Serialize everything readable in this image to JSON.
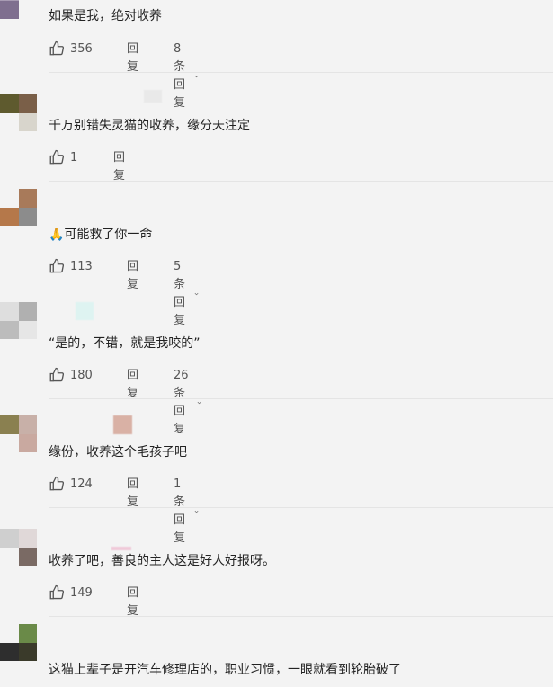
{
  "comments": [
    {
      "text": "如果是我，绝对收养",
      "likes": "356",
      "reply_label": "回复",
      "more_label": "8条回复"
    },
    {
      "text": "千万别错失灵猫的收养，缘分天注定",
      "likes": "1",
      "reply_label": "回复"
    },
    {
      "text": "🙏可能救了你一命",
      "likes": "113",
      "reply_label": "回复",
      "more_label": "5条回复"
    },
    {
      "text": "“是的，不错，就是我咬的”",
      "likes": "180",
      "reply_label": "回复",
      "more_label": "26条回复"
    },
    {
      "text": "缘份，收养这个毛孩子吧",
      "likes": "124",
      "reply_label": "回复",
      "more_label": "1条回复"
    },
    {
      "text": "收养了吧，善良的主人这是好人好报呀。",
      "likes": "149",
      "reply_label": "回复"
    },
    {
      "text": "这猫上辈子是开汽车修理店的，职业习惯，一眼就看到轮胎破了"
    }
  ],
  "icons": {
    "like": "thumbs-up-icon",
    "expand": "chevron-down-icon"
  },
  "colors": {
    "background": "#f3f3f3",
    "text": "#222222",
    "meta": "#666666",
    "divider": "#e4e4e4"
  }
}
